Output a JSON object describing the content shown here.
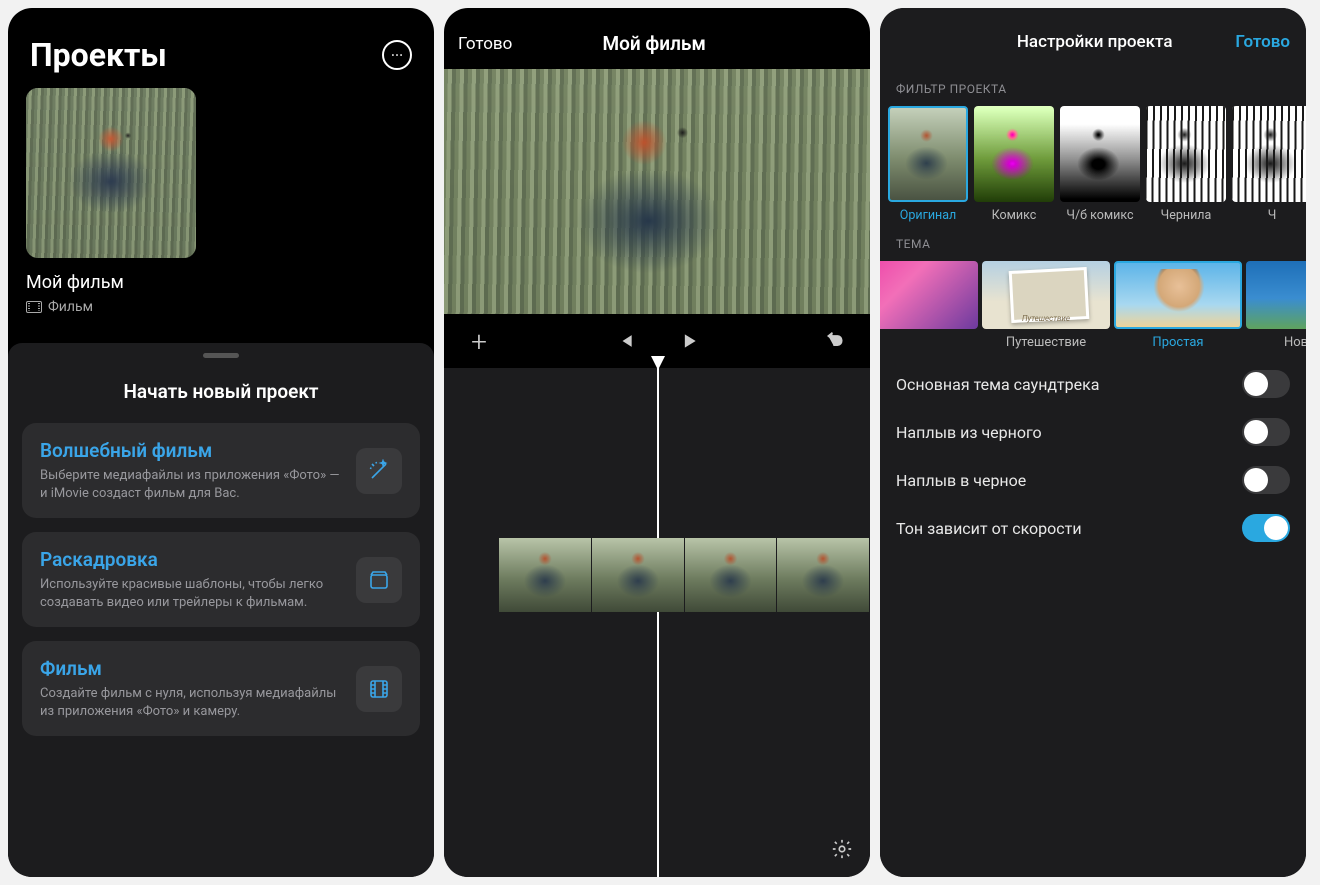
{
  "panel1": {
    "title": "Проекты",
    "project": {
      "name": "Мой фильм",
      "type": "Фильм"
    },
    "sheet": {
      "title": "Начать новый проект",
      "options": [
        {
          "title": "Волшебный фильм",
          "desc": "Выберите медиафайлы из приложения «Фото» — и iMovie создаст фильм для Вас.",
          "icon": "wand"
        },
        {
          "title": "Раскадровка",
          "desc": "Используйте красивые шаблоны, чтобы легко создавать видео или трейлеры к фильмам.",
          "icon": "storyboard"
        },
        {
          "title": "Фильм",
          "desc": "Создайте фильм с нуля, используя медиафайлы из приложения «Фото» и камеру.",
          "icon": "film"
        }
      ]
    }
  },
  "panel2": {
    "done": "Готово",
    "title": "Мой фильм"
  },
  "panel3": {
    "title": "Настройки проекта",
    "done": "Готово",
    "filterHeader": "ФИЛЬТР ПРОЕКТА",
    "filters": [
      {
        "label": "Оригинал",
        "selected": true,
        "style": "orig"
      },
      {
        "label": "Комикс",
        "style": "comic"
      },
      {
        "label": "Ч/б комикс",
        "style": "bwcomic"
      },
      {
        "label": "Чернила",
        "style": "ink"
      },
      {
        "label": "Ч",
        "style": "ink"
      }
    ],
    "themeHeader": "ТЕМА",
    "themes": [
      {
        "label": "",
        "style": "t0"
      },
      {
        "label": "Путешествие",
        "style": "t1",
        "caption": "Путешествие"
      },
      {
        "label": "Простая",
        "style": "t2",
        "selected": true
      },
      {
        "label": "Новости",
        "style": "t3"
      }
    ],
    "toggles": [
      {
        "label": "Основная тема саундтрека",
        "on": false
      },
      {
        "label": "Наплыв из черного",
        "on": false
      },
      {
        "label": "Наплыв в черное",
        "on": false
      },
      {
        "label": "Тон зависит от скорости",
        "on": true
      }
    ]
  }
}
